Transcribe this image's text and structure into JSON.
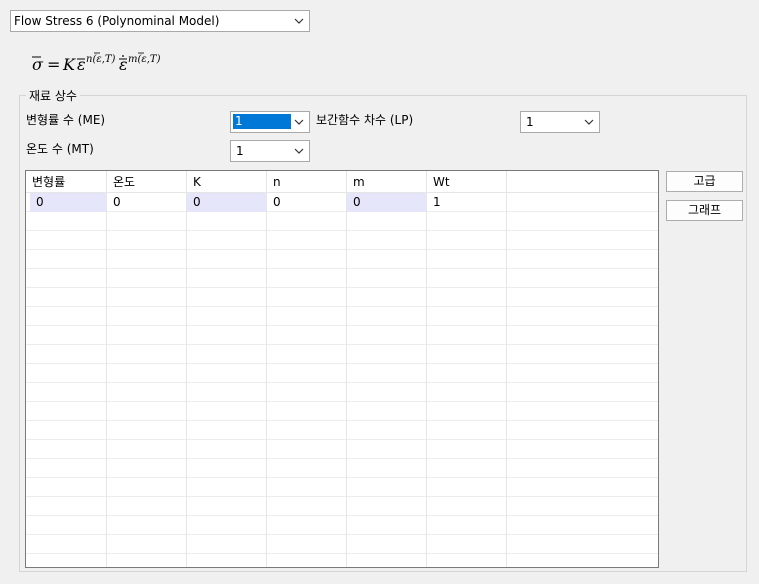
{
  "model_select": {
    "value": "Flow Stress 6 (Polynominal Model)"
  },
  "formula": {
    "text": "σ̄ = Kε̄^{n(ε̄,T)} ε̄̇^{m(ε̄,T)}"
  },
  "material_constants": {
    "title": "재료 상수",
    "me_label": "변형률 수 (ME)",
    "me_value": "1",
    "lp_label": "보간함수 차수 (LP)",
    "lp_value": "1",
    "mt_label": "온도 수 (MT)",
    "mt_value": "1"
  },
  "table": {
    "headers": [
      "변형률",
      "온도",
      "K",
      "n",
      "m",
      "Wt",
      ""
    ],
    "rows": [
      [
        "0",
        "0",
        "0",
        "0",
        "0",
        "1",
        ""
      ]
    ],
    "highlight_columns": [
      0,
      2,
      4
    ]
  },
  "buttons": {
    "advanced": "고급",
    "graph": "그래프"
  }
}
